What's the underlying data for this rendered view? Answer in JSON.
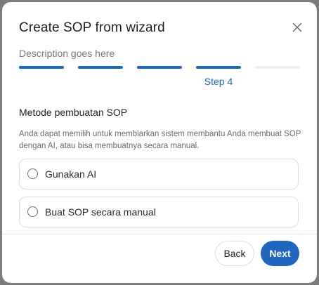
{
  "dialog": {
    "title": "Create SOP from wizard",
    "description": "Description goes here",
    "close_icon": "close-icon"
  },
  "stepper": {
    "total_steps": 5,
    "current_step": 4,
    "current_label": "Step 4",
    "active_color": "#1e64c8",
    "inactive_color": "#eeeeee"
  },
  "section": {
    "title": "Metode pembuatan SOP",
    "description": "Anda dapat memilih untuk membiarkan sistem membantu Anda membuat SOP dengan AI, atau bisa membuatnya secara manual."
  },
  "options": [
    {
      "label": "Gunakan AI",
      "selected": false
    },
    {
      "label": "Buat SOP secara manual",
      "selected": false
    }
  ],
  "footer": {
    "back_label": "Back",
    "next_label": "Next",
    "accent_color": "#1f66c1"
  }
}
